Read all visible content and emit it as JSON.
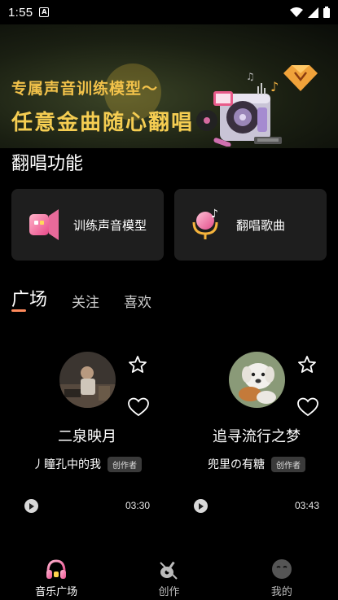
{
  "status_bar": {
    "time": "1:55",
    "notif_letter": "A"
  },
  "banner": {
    "line1": "专属声音训练模型～",
    "line2": "任意金曲随心翻唱"
  },
  "features": {
    "title": "翻唱功能",
    "items": [
      {
        "label": "训练声音模型",
        "icon": "voice-model-icon"
      },
      {
        "label": "翻唱歌曲",
        "icon": "cover-song-mic-icon"
      }
    ]
  },
  "tabs": [
    {
      "label": "广场",
      "active": true
    },
    {
      "label": "关注",
      "active": false
    },
    {
      "label": "喜欢",
      "active": false
    }
  ],
  "cards": [
    {
      "title": "二泉映月",
      "user": "丿瞳孔中的我",
      "badge": "创作者",
      "duration": "03:30"
    },
    {
      "title": "追寻流行之梦",
      "user": "兜里の有糖",
      "badge": "创作者",
      "duration": "03:43"
    }
  ],
  "bottom_nav": [
    {
      "label": "音乐广场",
      "icon": "music-plaza-icon",
      "active": true
    },
    {
      "label": "创作",
      "icon": "create-guitar-icon",
      "active": false
    },
    {
      "label": "我的",
      "icon": "profile-face-icon",
      "active": false
    }
  ],
  "colors": {
    "accent": "#ff8a5c",
    "gold": "#f5cd52",
    "card_bg": "#1e1e1e"
  }
}
